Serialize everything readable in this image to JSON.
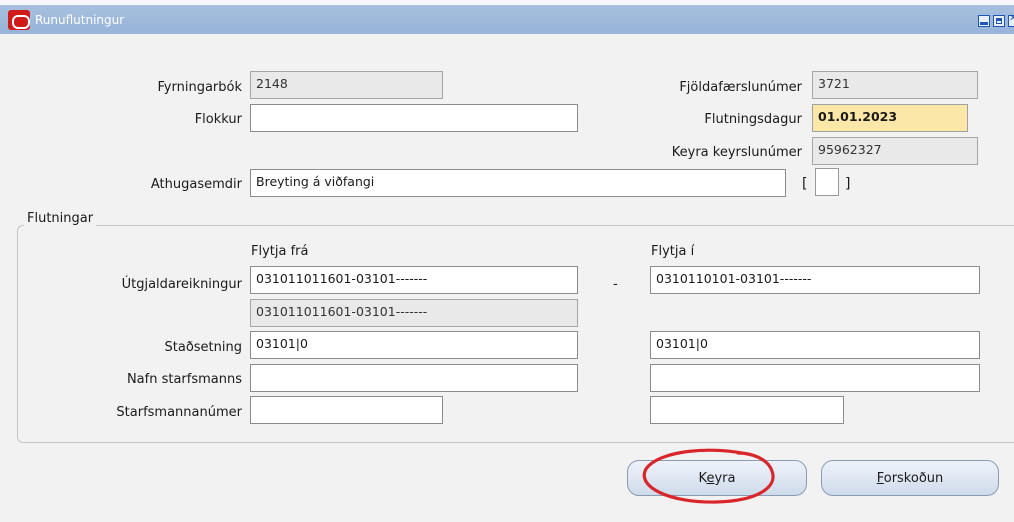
{
  "window": {
    "title": "Runuflutningur"
  },
  "form": {
    "fyrningarbok": {
      "label": "Fyrningarbók",
      "value": "2148"
    },
    "fjoldafaerslunumer": {
      "label": "Fjöldafærslunúmer",
      "value": "3721"
    },
    "flokkur": {
      "label": "Flokkur",
      "value": ""
    },
    "flutningsdagur": {
      "label": "Flutningsdagur",
      "value": "01.01.2023"
    },
    "keyra_keyrslunumer": {
      "label": "Keyra keyrslunúmer",
      "value": "95962327"
    },
    "athugasemdir": {
      "label": "Athugasemdir",
      "value": "Breyting á viðfangi"
    },
    "flex_open": "[",
    "flex_close": "]"
  },
  "transfers": {
    "group_title": "Flutningar",
    "from_header": "Flytja frá",
    "to_header": "Flytja í",
    "separator": "-",
    "utgjaldareikningur": {
      "label": "Útgjaldareikningur",
      "from": "031011011601-03101-------",
      "from_desc": "031011011601-03101-------",
      "to": "0310110101-03101-------"
    },
    "stadsetning": {
      "label": "Staðsetning",
      "from": "03101|0",
      "to": "03101|0"
    },
    "nafn_starfsmanns": {
      "label": "Nafn starfsmanns",
      "from": "",
      "to": ""
    },
    "starfsmannanumer": {
      "label": "Starfsmannanúmer",
      "from": "",
      "to": ""
    }
  },
  "buttons": {
    "keyra": {
      "pre": "K",
      "mnemonic": "e",
      "post": "yra"
    },
    "forskodun": {
      "pre": "",
      "mnemonic": "F",
      "post": "orskoðun"
    }
  },
  "colors": {
    "annotation_circle": "#d9262b",
    "title_bar": "#97b3d8",
    "highlight_field": "#fbe7a7"
  }
}
